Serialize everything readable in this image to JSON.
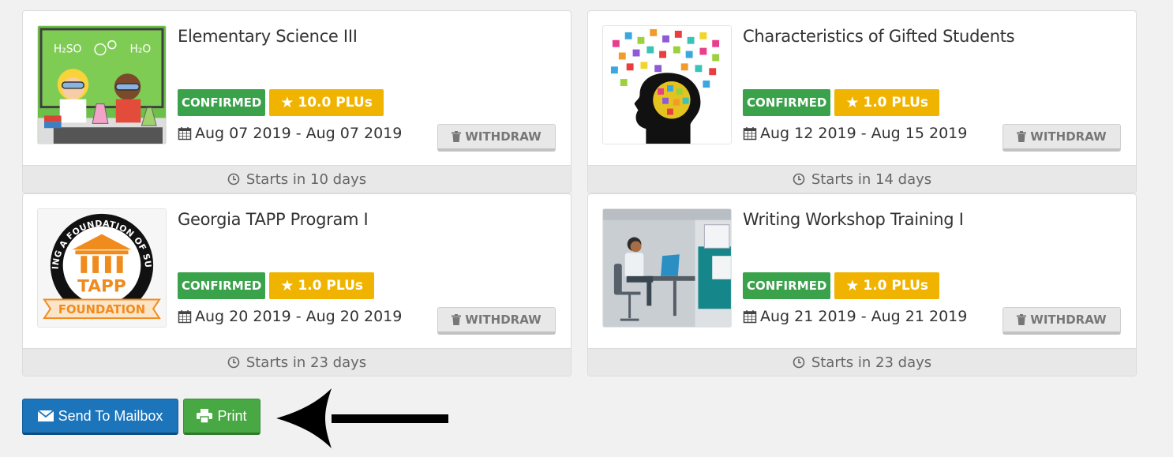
{
  "courses": [
    {
      "title": "Elementary Science III",
      "status": "CONFIRMED",
      "plus": "10.0 PLUs",
      "dates": "Aug 07 2019 - Aug 07 2019",
      "withdraw": "WITHDRAW",
      "starts": "Starts in 10 days",
      "thumb": "science-classroom-image"
    },
    {
      "title": "Characteristics of Gifted Students",
      "status": "CONFIRMED",
      "plus": "1.0 PLUs",
      "dates": "Aug 12 2019 - Aug 15 2019",
      "withdraw": "WITHDRAW",
      "starts": "Starts in 14 days",
      "thumb": "puzzle-head-image"
    },
    {
      "title": "Georgia TAPP Program I",
      "status": "CONFIRMED",
      "plus": "1.0 PLUs",
      "dates": "Aug 20 2019 - Aug 20 2019",
      "withdraw": "WITHDRAW",
      "starts": "Starts in 23 days",
      "thumb": "tapp-foundation-logo",
      "logo_text": [
        "BUILDING A FOUNDATION OF SUCCESS",
        "TAPP",
        "FOUNDATION"
      ]
    },
    {
      "title": "Writing Workshop Training I",
      "status": "CONFIRMED",
      "plus": "1.0 PLUs",
      "dates": "Aug 21 2019 - Aug 21 2019",
      "withdraw": "WITHDRAW",
      "starts": "Starts in 23 days",
      "thumb": "office-worker-image"
    }
  ],
  "actions": {
    "send_label": "Send To Mailbox",
    "print_label": "Print"
  },
  "colors": {
    "confirmed": "#3aa24a",
    "plus": "#f0b400",
    "mail_button": "#1c75bb",
    "print_button": "#48a843"
  }
}
